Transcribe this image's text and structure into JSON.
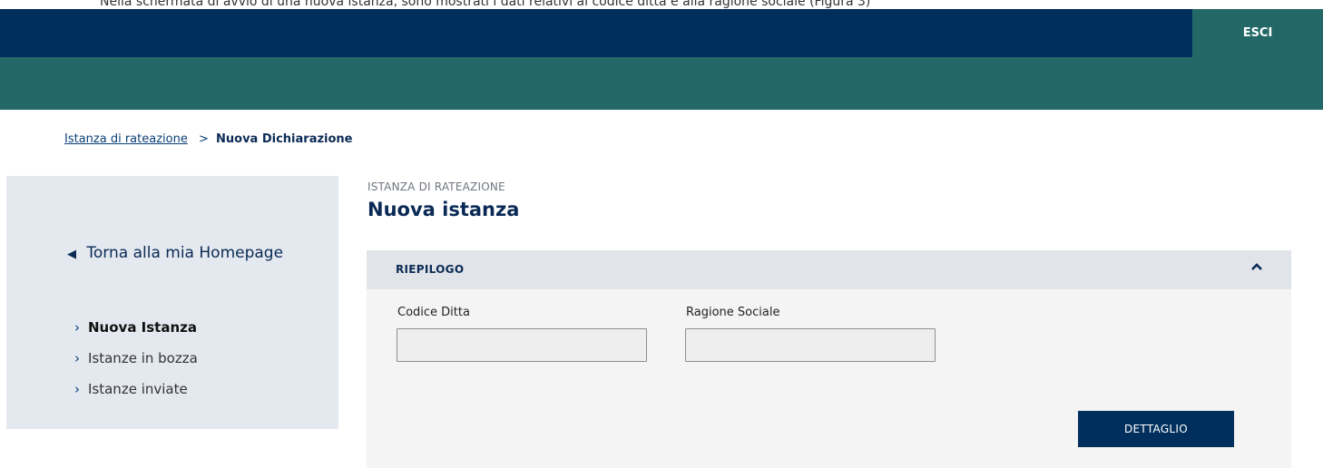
{
  "page_caption": "Nella schermata di avvio di una nuova istanza, sono mostrati i dati relativi al codice ditta e alla ragione sociale (Figura 3)",
  "header": {
    "exit_label": "ESCI"
  },
  "breadcrumb": {
    "parent": "Istanza di rateazione",
    "separator": ">",
    "current": "Nuova Dichiarazione"
  },
  "sidebar": {
    "back_label": "Torna alla mia Homepage",
    "items": [
      {
        "label": "Nuova Istanza",
        "active": true
      },
      {
        "label": "Istanze in bozza",
        "active": false
      },
      {
        "label": "Istanze inviate",
        "active": false
      }
    ]
  },
  "main": {
    "subtitle": "ISTANZA DI RATEAZIONE",
    "title": "Nuova istanza",
    "panel": {
      "title": "RIEPILOGO",
      "fields": [
        {
          "label": "Codice Ditta",
          "value": ""
        },
        {
          "label": "Ragione Sociale",
          "value": ""
        }
      ],
      "detail_button": "DETTAGLIO"
    }
  },
  "colors": {
    "navy": "#002f5e",
    "teal": "#236767",
    "sidebar_bg": "#e4e9ef",
    "panel_bg": "#f4f4f4"
  }
}
